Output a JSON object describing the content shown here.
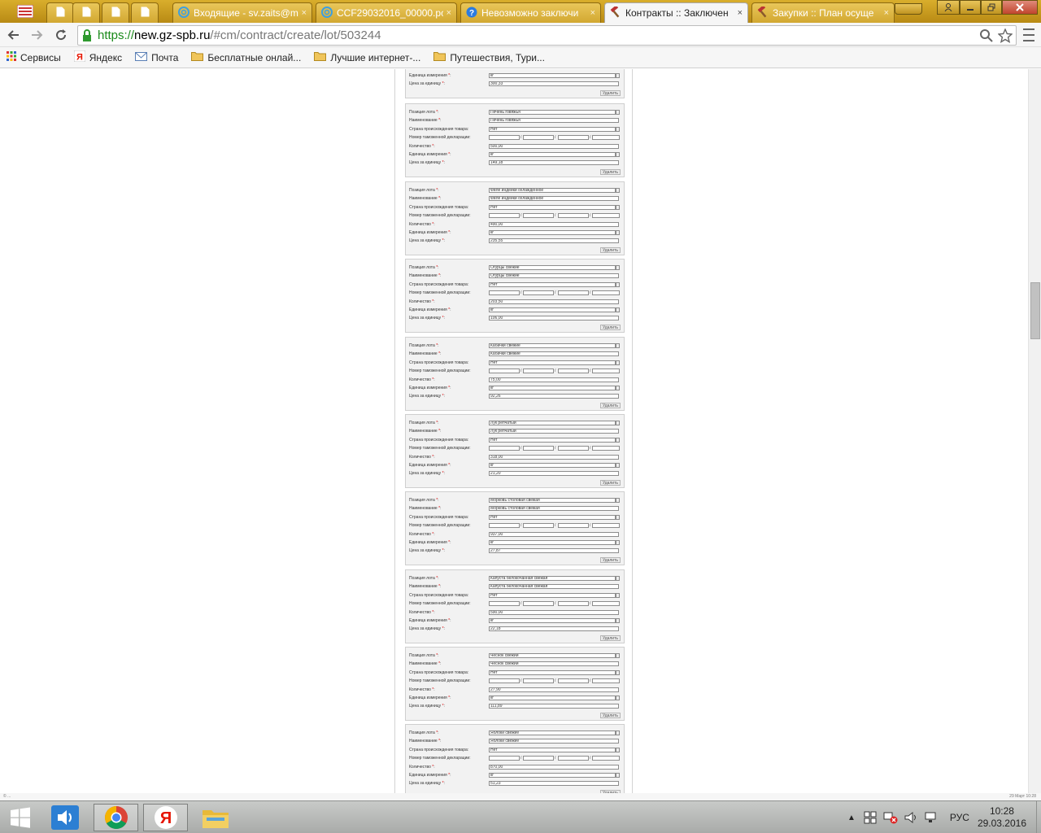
{
  "browser": {
    "tabs": [
      {
        "title": "",
        "kind": "doc",
        "active": false
      },
      {
        "title": "",
        "kind": "doc",
        "active": false
      },
      {
        "title": "",
        "kind": "doc",
        "active": false
      },
      {
        "title": "",
        "kind": "doc",
        "active": false
      },
      {
        "title": "Входящие - sv.zaits@m",
        "kind": "mail",
        "active": false
      },
      {
        "title": "CCF29032016_00000.pc",
        "kind": "mail",
        "active": false
      },
      {
        "title": "Невозможно заключи",
        "kind": "help",
        "active": false
      },
      {
        "title": "Контракты :: Заключен",
        "kind": "hammer",
        "active": true
      },
      {
        "title": "Закупки :: План осуще",
        "kind": "hammer",
        "active": false
      }
    ],
    "close_glyph": "×",
    "url": {
      "protocol": "https://",
      "host": "new.gz-spb.ru",
      "path": "/#cm/contract/create/lot/503244"
    },
    "bookmarks": [
      {
        "label": "Сервисы",
        "icon": "apps-icon"
      },
      {
        "label": "Яндекс",
        "icon": "yandex-icon"
      },
      {
        "label": "Почта",
        "icon": "mail-icon"
      },
      {
        "label": "Бесплатные онлай...",
        "icon": "folder-icon"
      },
      {
        "label": "Лучшие интернет-...",
        "icon": "folder-icon"
      },
      {
        "label": "Путешествия, Тури...",
        "icon": "folder-icon"
      }
    ]
  },
  "form": {
    "labels": {
      "position": "Позиция лота",
      "name": "Наименование",
      "country": "Страна происхождения товара:",
      "customs": "Номер таможенной декларации:",
      "quantity": "Количество",
      "unit": "Единица измерения",
      "price": "Цена за единицу",
      "required_mark": "*",
      "colon": ":",
      "delete": "Удалить",
      "slash": "/"
    },
    "partial": {
      "unit": "кг",
      "price": "300,33"
    },
    "items": [
      {
        "position": "Печень говяжья",
        "name": "Печень говяжья",
        "country": "Нет",
        "quantity": "500,00",
        "unit": "кг",
        "price": "149,18"
      },
      {
        "position": "Филе индейки охлажденное",
        "name": "Филе индейки охлажденное",
        "country": "Нет",
        "quantity": "490,00",
        "unit": "кг",
        "price": "235,55"
      },
      {
        "position": "Огурцы свежие",
        "name": "Огурцы свежие",
        "country": "Нет",
        "quantity": "203,50",
        "unit": "кг",
        "price": "106,00"
      },
      {
        "position": "Кабачки свежие",
        "name": "Кабачки свежие",
        "country": "Нет",
        "quantity": "75,00",
        "unit": "кг",
        "price": "92,26"
      },
      {
        "position": "Лук репчатый",
        "name": "Лук репчатый",
        "country": "Нет",
        "quantity": "318,00",
        "unit": "кг",
        "price": "21,20"
      },
      {
        "position": "Морковь столовая свежая",
        "name": "Морковь столовая свежая",
        "country": "Нет",
        "quantity": "937,00",
        "unit": "кг",
        "price": "27,87"
      },
      {
        "position": "Капуста белокочанная свежая",
        "name": "Капуста белокочанная свежая",
        "country": "Нет",
        "quantity": "590,00",
        "unit": "кг",
        "price": "22,18"
      },
      {
        "position": "Чеснок свежий",
        "name": "Чеснок свежий",
        "country": "Нет",
        "quantity": "27,90",
        "unit": "кг",
        "price": "111,89"
      },
      {
        "position": "Яблоки свежие",
        "name": "Яблоки свежие",
        "country": "Нет",
        "quantity": "870,00",
        "unit": "кг",
        "price": "51,23"
      }
    ]
  },
  "statusbar": {
    "left": "© ...",
    "right": "29 Март  10:28"
  },
  "taskbar": {
    "language": "РУС",
    "time": "10:28",
    "date": "29.03.2016"
  },
  "colors": {
    "tab_inactive": "#d2a731",
    "tab_active": "#f6f6f6",
    "url_secure": "#1a8a1a",
    "required": "#dd0000"
  }
}
